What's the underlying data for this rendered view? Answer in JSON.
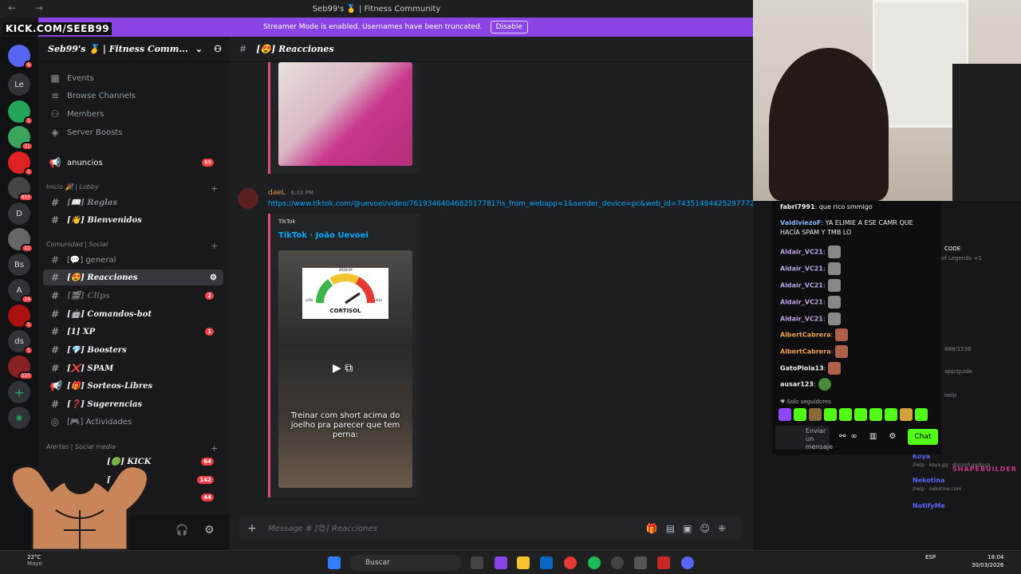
{
  "window": {
    "title": "Seb99's 🥇 | Fitness Community"
  },
  "overlay": {
    "kick_handle": "KICK.COM/SEEB99",
    "brand": "SHAPEBUILDER"
  },
  "banner": {
    "text": "Streamer Mode is enabled. Usernames have been truncated.",
    "button": "Disable"
  },
  "rail": {
    "items": [
      {
        "label": "",
        "badge": "1"
      },
      {
        "label": "",
        "badge": "6"
      },
      {
        "label": "Le",
        "badge": ""
      },
      {
        "label": "",
        "badge": "1"
      },
      {
        "label": "",
        "badge": "31"
      },
      {
        "label": "",
        "badge": "1"
      },
      {
        "label": "",
        "badge": "455"
      },
      {
        "label": "D",
        "badge": ""
      },
      {
        "label": "",
        "badge": "11"
      },
      {
        "label": "Bs",
        "badge": "1"
      },
      {
        "label": "A",
        "badge": "14"
      },
      {
        "label": "",
        "badge": "1"
      },
      {
        "label": "ds",
        "badge": "1"
      },
      {
        "label": "",
        "badge": "337"
      }
    ]
  },
  "server": {
    "name": "Seb99's 🥇 | Fitness Comm..."
  },
  "sidebar": {
    "top": [
      {
        "label": "Events",
        "icon": "calendar-icon"
      },
      {
        "label": "Browse Channels",
        "icon": "browse-icon"
      },
      {
        "label": "Members",
        "icon": "members-icon"
      },
      {
        "label": "Server Boosts",
        "icon": "boost-icon"
      }
    ],
    "anuncios": {
      "label": "anuncios",
      "count": "89"
    },
    "cat1": "Inicio 🎉 | Lobby",
    "lobby": [
      {
        "label": "Reglas",
        "prefix": "[📖]"
      },
      {
        "label": "Bienvenidos",
        "prefix": "[👋]"
      }
    ],
    "cat2": "Comunidad | Social",
    "comunidad": [
      {
        "label": "general",
        "prefix": "[💬]",
        "count": ""
      },
      {
        "label": "Reacciones",
        "prefix": "[😍]",
        "count": ""
      },
      {
        "label": "Clips",
        "prefix": "[🎬]",
        "count": "2"
      },
      {
        "label": "Comandos-bot",
        "prefix": "[🤖]",
        "count": ""
      },
      {
        "label": "XP",
        "prefix": "[1]",
        "count": "1"
      },
      {
        "label": "Boosters",
        "prefix": "[💎]",
        "count": ""
      },
      {
        "label": "SPAM",
        "prefix": "[❌]",
        "count": ""
      },
      {
        "label": "Sorteos-Libres",
        "prefix": "[🎁]",
        "count": ""
      },
      {
        "label": "Sugerencias",
        "prefix": "[❓]",
        "count": ""
      },
      {
        "label": "Actividades",
        "prefix": "[🎮]",
        "count": ""
      }
    ],
    "cat3": "Alertas | Social media",
    "alertas": [
      {
        "label": "KICK",
        "prefix": "[🟢]",
        "count": "64"
      },
      {
        "label": "",
        "prefix": "[",
        "count": "142"
      },
      {
        "label": "gram",
        "prefix": "",
        "count": "44"
      }
    ]
  },
  "channel": {
    "name": "Reacciones",
    "prefix": "[😍]",
    "composer_placeholder": "Message #",
    "composer_channel": "Reacciones"
  },
  "message": {
    "author": "daeL",
    "time": "6:03 PM",
    "link": "https://www.tiktok.com/@uevoei/video/7619346404682517781?is_from_webapp=1&sender_device=pc&web_id=7435148442529777208",
    "provider": "TikTok",
    "embed_title": "TikTok · João Uevoei",
    "gauge_top": "MEDIUM",
    "gauge_low": "LOW",
    "gauge_high": "HIGH",
    "gauge_label": "CORTISOL",
    "caption": "Treinar com short acima do joelho pra parecer que tem perna:"
  },
  "chat": {
    "messages": [
      {
        "user": "fabri7991",
        "text": "que rico smmigo"
      },
      {
        "user": "ValdiviezoF",
        "text": "YA ELIMIE A ESE CAMR QUE HACÍA SPAM Y TMB LO"
      },
      {
        "user": "Aldair_VC21",
        "text": ""
      },
      {
        "user": "Aldair_VC21",
        "text": ""
      },
      {
        "user": "Aldair_VC21",
        "text": ""
      },
      {
        "user": "Aldair_VC21",
        "text": ""
      },
      {
        "user": "Aldair_VC21",
        "text": ""
      },
      {
        "user": "AlbertCabrera",
        "text": ""
      },
      {
        "user": "AlbertCabrera",
        "text": ""
      },
      {
        "user": "GatoPiola13",
        "text": ""
      },
      {
        "user": "ausar123",
        "text": ""
      }
    ],
    "followers_only": "Solo seguidores",
    "input_placeholder": "Enviar un mensaje",
    "send_button": "Chat"
  },
  "members": {
    "code_label": "CODE",
    "sub": "of Legends +1",
    "app": "APP",
    "koya": "Koya",
    "koya_sub": "/help · koya.gg · discord.gg/koya",
    "nekotina": "Nekotina",
    "nekotina_sub": "/help · nekotina.com",
    "notifyme": "NotifyMe",
    "guide": "app/guide",
    "num": "888/1536",
    "help": "help"
  },
  "taskbar": {
    "search": "Buscar",
    "weather": "22°C",
    "weather_sub": "Mayo",
    "lang": "ESP",
    "time": "18:04",
    "date": "30/03/2026"
  },
  "colors": {
    "banner": "#8a44e6",
    "embed_border": "#e04e79",
    "link": "#00a8fc",
    "badge": "#f23f43",
    "kick_green": "#53fc18"
  }
}
